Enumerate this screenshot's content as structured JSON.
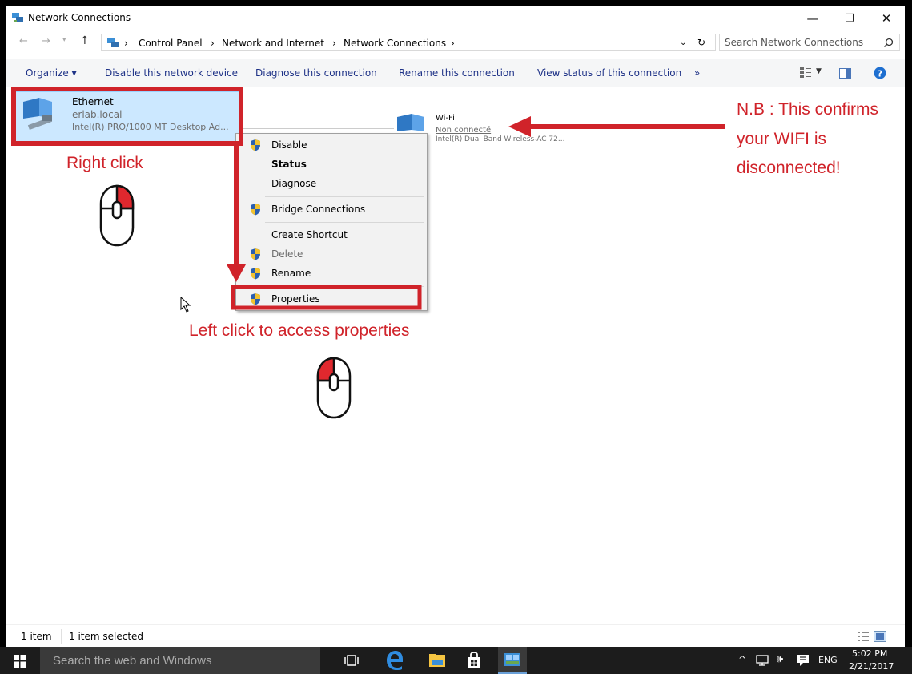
{
  "window": {
    "title": "Network Connections",
    "controls": {
      "minimize": "—",
      "maximize": "❐",
      "close": "✕"
    }
  },
  "address": {
    "breadcrumbs": [
      "Control Panel",
      "Network and Internet",
      "Network Connections"
    ],
    "search_placeholder": "Search Network Connections"
  },
  "toolbar": {
    "organize": "Organize ▾",
    "disable": "Disable this network device",
    "diagnose": "Diagnose this connection",
    "rename": "Rename this connection",
    "view_status": "View status of this connection",
    "more": "»"
  },
  "connections": [
    {
      "name": "Ethernet",
      "status": "erlab.local",
      "device": "Intel(R) PRO/1000 MT Desktop Ad..."
    },
    {
      "name": "Wi-Fi",
      "status": "Non connecté",
      "device": "Intel(R) Dual Band Wireless-AC 72..."
    }
  ],
  "context_menu": {
    "items": [
      {
        "label": "Disable",
        "shield": true,
        "bold": false,
        "disabled": false
      },
      {
        "label": "Status",
        "shield": false,
        "bold": true,
        "disabled": false
      },
      {
        "label": "Diagnose",
        "shield": false,
        "bold": false,
        "disabled": false
      },
      {
        "label": "Bridge Connections",
        "shield": true,
        "bold": false,
        "disabled": false
      },
      {
        "label": "Create Shortcut",
        "shield": false,
        "bold": false,
        "disabled": false
      },
      {
        "label": "Delete",
        "shield": true,
        "bold": false,
        "disabled": true
      },
      {
        "label": "Rename",
        "shield": true,
        "bold": false,
        "disabled": false
      },
      {
        "label": "Properties",
        "shield": true,
        "bold": false,
        "disabled": false
      }
    ]
  },
  "annotations": {
    "right_click": "Right click",
    "left_click": "Left click to access properties",
    "note_line1": "N.B : This confirms",
    "note_line2": "your WIFI is",
    "note_line3": "disconnected!",
    "color": "#d0232a"
  },
  "status": {
    "count": "1 item",
    "selected": "1 item selected"
  },
  "taskbar": {
    "search_placeholder": "Search the web and Windows",
    "language": "ENG",
    "time": "5:02 PM",
    "date": "2/21/2017"
  }
}
